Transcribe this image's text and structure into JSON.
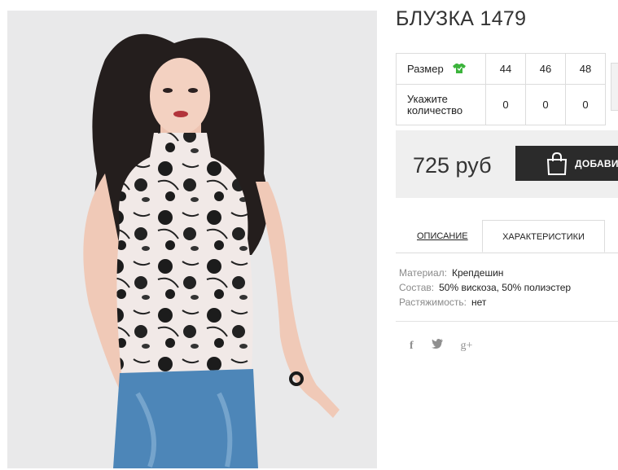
{
  "product": {
    "title": "БЛУЗКА 1479",
    "sizes_label": "Размер",
    "sizes": [
      "44",
      "46",
      "48"
    ],
    "qty_label": "Укажите количество",
    "quantities": [
      "0",
      "0",
      "0"
    ],
    "price": "725 руб",
    "add_button": "ДОБАВИТ"
  },
  "tabs": [
    {
      "label": "ОПИСАНИЕ",
      "active": false
    },
    {
      "label": "ХАРАКТЕРИСТИКИ",
      "active": true
    }
  ],
  "characteristics": [
    {
      "key": "Материал:",
      "value": "Крепдешин"
    },
    {
      "key": "Состав:",
      "value": "50% вискоза, 50% полиэстер"
    },
    {
      "key": "Растяжимость:",
      "value": "нет"
    }
  ],
  "social": {
    "facebook": "f",
    "twitter": "twitter-icon",
    "gplus": "g+"
  },
  "colors": {
    "button": "#2b2b2b",
    "size_icon": "#3cb43c",
    "price_bg": "#efefef"
  }
}
